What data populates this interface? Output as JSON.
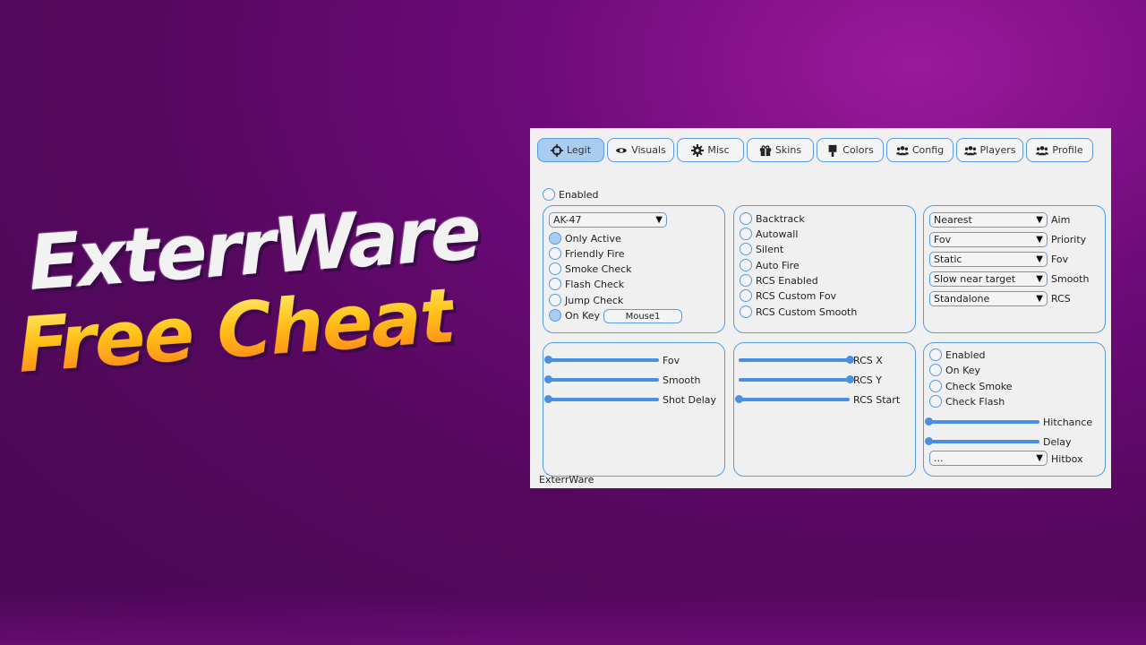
{
  "promo": {
    "line1": "ExterrWare",
    "line2": "Free Cheat"
  },
  "tabs": [
    {
      "label": "Legit",
      "icon": "crosshair-icon",
      "active": true
    },
    {
      "label": "Visuals",
      "icon": "eye-icon",
      "active": false
    },
    {
      "label": "Misc",
      "icon": "gear-icon",
      "active": false
    },
    {
      "label": "Skins",
      "icon": "gift-icon",
      "active": false
    },
    {
      "label": "Colors",
      "icon": "paintbrush-icon",
      "active": false
    },
    {
      "label": "Config",
      "icon": "users-icon",
      "active": false
    },
    {
      "label": "Players",
      "icon": "users-icon",
      "active": false
    },
    {
      "label": "Profile",
      "icon": "users-icon",
      "active": false
    }
  ],
  "enabled_label": "Enabled",
  "weapon_panel": {
    "weapon": "AK-47",
    "options": [
      "Only Active",
      "Friendly Fire",
      "Smoke Check",
      "Flash Check",
      "Jump Check",
      "On Key"
    ],
    "key": "Mouse1"
  },
  "misc_panel": {
    "options": [
      "Backtrack",
      "Autowall",
      "Silent",
      "Auto Fire",
      "RCS Enabled",
      "RCS Custom Fov",
      "RCS Custom Smooth"
    ]
  },
  "aim_panel": {
    "rows": [
      {
        "value": "Nearest",
        "label": "Aim"
      },
      {
        "value": "Fov",
        "label": "Priority"
      },
      {
        "value": "Static",
        "label": "Fov"
      },
      {
        "value": "Slow near target",
        "label": "Smooth"
      },
      {
        "value": "Standalone",
        "label": "RCS"
      }
    ]
  },
  "sliders_left": [
    {
      "label": "Fov",
      "value": 0.0
    },
    {
      "label": "Smooth",
      "value": 0.0
    },
    {
      "label": "Shot Delay",
      "value": 0.0
    }
  ],
  "sliders_mid": [
    {
      "label": "RCS X",
      "value": 1.0
    },
    {
      "label": "RCS Y",
      "value": 1.0
    },
    {
      "label": "RCS Start",
      "value": 0.0
    }
  ],
  "trigger_panel": {
    "options": [
      "Enabled",
      "On Key",
      "Check Smoke",
      "Check Flash"
    ],
    "sliders": [
      {
        "label": "Hitchance",
        "value": 0.0
      },
      {
        "label": "Delay",
        "value": 0.0
      }
    ],
    "hitbox_value": "...",
    "hitbox_label": "Hitbox"
  },
  "footer": "ExterrWare",
  "colors": {
    "accent": "#5b9be0",
    "active_tab": "#a9cdf0",
    "slider": "#4a90e2"
  }
}
